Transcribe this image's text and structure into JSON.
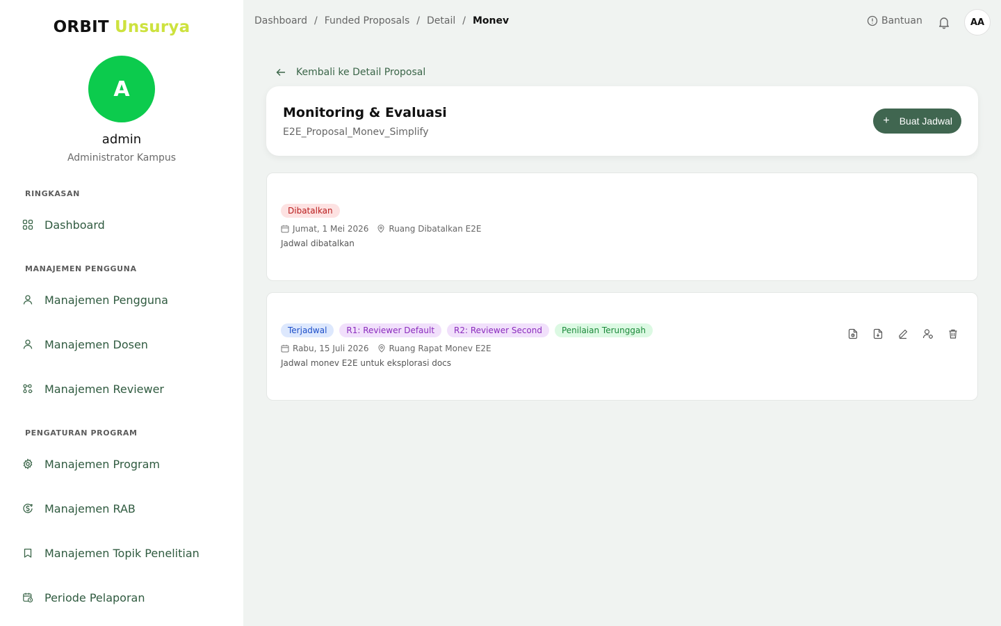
{
  "brand": {
    "part1": "ORBIT",
    "part2": "Unsurya"
  },
  "user": {
    "initial": "A",
    "name": "admin",
    "role": "Administrator Kampus",
    "avatar_initials": "AA"
  },
  "sidebar": {
    "sections": [
      {
        "label": "RINGKASAN"
      },
      {
        "label": "MANAJEMEN PENGGUNA"
      },
      {
        "label": "PENGATURAN PROGRAM"
      }
    ],
    "items": [
      {
        "label": "Dashboard",
        "icon": "grid-icon"
      },
      {
        "label": "Manajemen Pengguna",
        "icon": "user-icon"
      },
      {
        "label": "Manajemen Dosen",
        "icon": "user-icon"
      },
      {
        "label": "Manajemen Reviewer",
        "icon": "network-icon"
      },
      {
        "label": "Manajemen Program",
        "icon": "gear-icon"
      },
      {
        "label": "Manajemen RAB",
        "icon": "dollar-circle-icon"
      },
      {
        "label": "Manajemen Topik Penelitian",
        "icon": "bookmark-icon"
      },
      {
        "label": "Periode Pelaporan",
        "icon": "calendar-clock-icon"
      }
    ]
  },
  "breadcrumb": [
    "Dashboard",
    "Funded Proposals",
    "Detail",
    "Monev"
  ],
  "topbar": {
    "help_label": "Bantuan"
  },
  "back_label": "Kembali ke Detail Proposal",
  "page": {
    "title": "Monitoring & Evaluasi",
    "subtitle": "E2E_Proposal_Monev_Simplify",
    "create_button": "Buat Jadwal"
  },
  "schedules": [
    {
      "badges": [
        "Dibatalkan"
      ],
      "date": "Jumat, 1 Mei 2026",
      "location": "Ruang Dibatalkan E2E",
      "description": "Jadwal dibatalkan"
    },
    {
      "badges": [
        "Terjadwal",
        "R1: Reviewer Default",
        "R2: Reviewer Second",
        "Penilaian Terunggah"
      ],
      "date": "Rabu, 15 Juli 2026",
      "location": "Ruang Rapat Monev E2E",
      "description": "Jadwal monev E2E untuk eksplorasi docs"
    }
  ],
  "colors": {
    "brand_accent": "#cde23e",
    "avatar_bg": "#0ccb4d",
    "primary_button": "#406650",
    "nav_text": "#2f5a3f"
  }
}
